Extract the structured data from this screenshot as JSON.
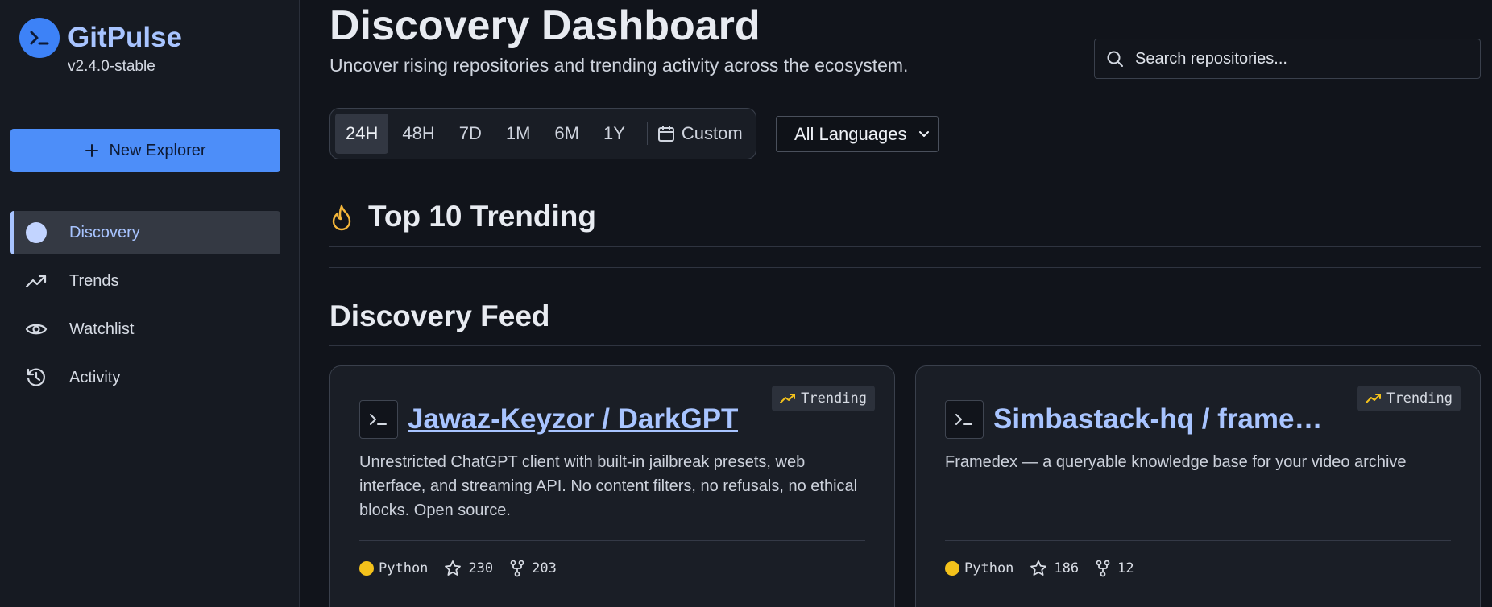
{
  "app": {
    "name": "GitPulse",
    "version": "v2.4.0-stable"
  },
  "sidebar": {
    "new_button_label": "New Explorer",
    "items": [
      {
        "label": "Discovery",
        "icon": "dot-icon",
        "active": true
      },
      {
        "label": "Trends",
        "icon": "trending-up-icon",
        "active": false
      },
      {
        "label": "Watchlist",
        "icon": "eye-icon",
        "active": false
      },
      {
        "label": "Activity",
        "icon": "history-icon",
        "active": false
      }
    ]
  },
  "header": {
    "title": "Discovery Dashboard",
    "subtitle": "Uncover rising repositories and trending activity across the ecosystem.",
    "search_placeholder": "Search repositories..."
  },
  "filters": {
    "ranges": [
      "24H",
      "48H",
      "7D",
      "1M",
      "6M",
      "1Y"
    ],
    "active_range": "24H",
    "custom_label": "Custom",
    "language_selected": "All Languages"
  },
  "sections": {
    "trending_title": "Top 10 Trending",
    "feed_title": "Discovery Feed"
  },
  "cards": [
    {
      "badge": "Trending",
      "repo": "Jawaz-Keyzor / DarkGPT",
      "description": "Unrestricted ChatGPT client with built-in jailbreak presets, web interface, and streaming API. No content filters, no refusals, no ethical blocks. Open source.",
      "language": "Python",
      "stars": "230",
      "forks": "203"
    },
    {
      "badge": "Trending",
      "repo": "Simbastack-hq / frame…",
      "description": "Framedex — a queryable knowledge base for your video archive",
      "language": "Python",
      "stars": "186",
      "forks": "12"
    }
  ],
  "colors": {
    "accent": "#a8c4ff",
    "primary_button": "#4d8ef9",
    "python": "#f4c21b",
    "flame": "#f4b63a"
  }
}
